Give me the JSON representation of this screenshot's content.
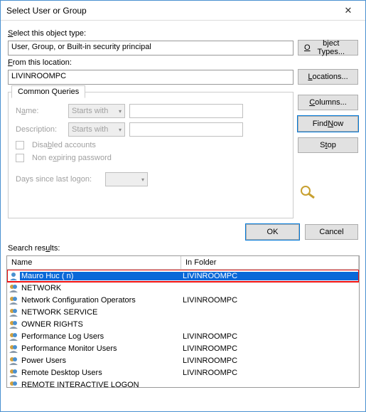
{
  "window": {
    "title": "Select User or Group"
  },
  "object_type": {
    "label": "Select this object type:",
    "value": "User, Group, or Built-in security principal",
    "btn": "Object Types..."
  },
  "location": {
    "label": "From this location:",
    "value": "LIVINROOMPC",
    "btn": "Locations..."
  },
  "queries": {
    "tab": "Common Queries",
    "name_lbl": "Name:",
    "desc_lbl": "Description:",
    "starts": "Starts with",
    "disabled": "Disabled accounts",
    "nonexp": "Non expiring password",
    "days_lbl": "Days since last logon:"
  },
  "side": {
    "columns": "Columns...",
    "find": "Find Now",
    "stop": "Stop"
  },
  "dlg": {
    "ok": "OK",
    "cancel": "Cancel"
  },
  "results": {
    "label": "Search results:",
    "col_name": "Name",
    "col_folder": "In Folder",
    "items": [
      {
        "name": "Mauro Huc (                                 n)",
        "folder": "LIVINROOMPC",
        "icon": "user",
        "selected": true
      },
      {
        "name": "NETWORK",
        "folder": "",
        "icon": "group"
      },
      {
        "name": "Network Configuration Operators",
        "folder": "LIVINROOMPC",
        "icon": "group"
      },
      {
        "name": "NETWORK SERVICE",
        "folder": "",
        "icon": "group"
      },
      {
        "name": "OWNER RIGHTS",
        "folder": "",
        "icon": "group"
      },
      {
        "name": "Performance Log Users",
        "folder": "LIVINROOMPC",
        "icon": "group"
      },
      {
        "name": "Performance Monitor Users",
        "folder": "LIVINROOMPC",
        "icon": "group"
      },
      {
        "name": "Power Users",
        "folder": "LIVINROOMPC",
        "icon": "group"
      },
      {
        "name": "Remote Desktop Users",
        "folder": "LIVINROOMPC",
        "icon": "group"
      },
      {
        "name": "REMOTE INTERACTIVE LOGON",
        "folder": "",
        "icon": "group"
      }
    ]
  }
}
